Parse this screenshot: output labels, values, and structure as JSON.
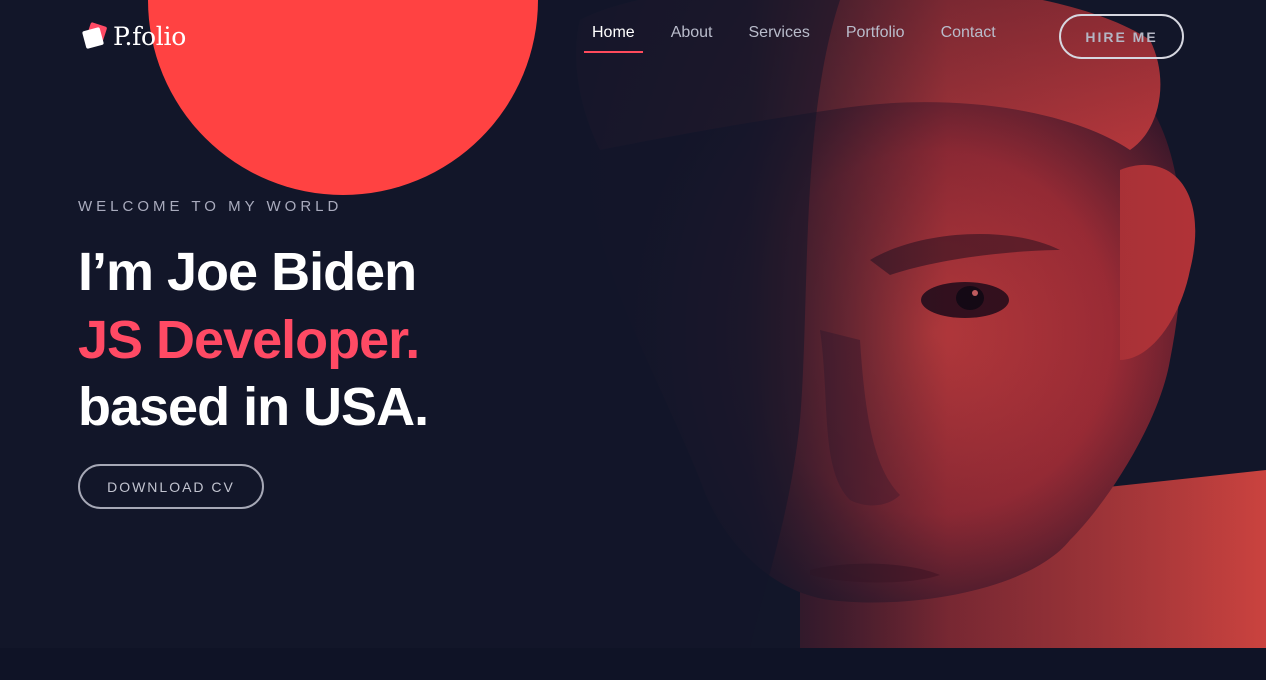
{
  "brand": {
    "name": "P.folio",
    "icon": "logo-squares-icon",
    "accent": "#ff4a64"
  },
  "nav": {
    "items": [
      {
        "label": "Home",
        "active": true
      },
      {
        "label": "About",
        "active": false
      },
      {
        "label": "Services",
        "active": false
      },
      {
        "label": "Portfolio",
        "active": false
      },
      {
        "label": "Contact",
        "active": false
      }
    ],
    "cta_label": "HIRE ME"
  },
  "hero": {
    "eyebrow": "WELCOME TO MY WORLD",
    "line1": "I’m Joe Biden",
    "line2": "JS Developer.",
    "line3": "based in USA.",
    "button_label": "DOWNLOAD CV",
    "background_color": "#121629",
    "circle_color": "#ff4242",
    "photo_tint": "#d9383c"
  }
}
